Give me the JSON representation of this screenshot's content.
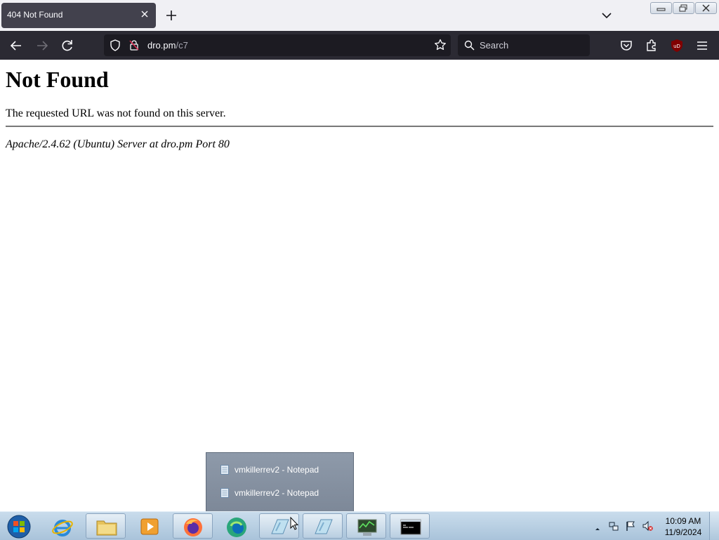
{
  "browser": {
    "tab": {
      "title": "404 Not Found"
    },
    "address": {
      "host": "dro.pm",
      "path": "/c7"
    },
    "search": {
      "placeholder": "Search"
    },
    "icons": {
      "back": "arrow-left-icon",
      "forward": "arrow-right-icon",
      "reload": "reload-icon",
      "shield": "shield-icon",
      "lock": "lock-icon",
      "bookmark": "star-icon",
      "pocket": "pocket-icon",
      "extensions": "puzzle-icon",
      "ublock": "ublock-icon",
      "menu": "hamburger-menu-icon"
    }
  },
  "page": {
    "heading": "Not Found",
    "message": "The requested URL was not found on this server.",
    "address": "Apache/2.4.62 (Ubuntu) Server at dro.pm Port 80"
  },
  "taskbar": {
    "popup": {
      "items": [
        {
          "label": "vmkillerrev2 - Notepad"
        },
        {
          "label": "vmkillerrev2 - Notepad"
        }
      ]
    },
    "apps": [
      "start-orb-icon",
      "internet-explorer-icon",
      "file-explorer-icon",
      "media-player-icon",
      "firefox-icon",
      "edge-icon",
      "notepad-icon",
      "notepad-icon",
      "task-manager-icon",
      "command-prompt-icon"
    ],
    "clock": {
      "time": "10:09 AM",
      "date": "11/9/2024"
    }
  },
  "colors": {
    "tab_active": "#42414d",
    "toolbar": "#2b2a33",
    "urlbar": "#1c1b22",
    "ublock_red": "#800000"
  }
}
